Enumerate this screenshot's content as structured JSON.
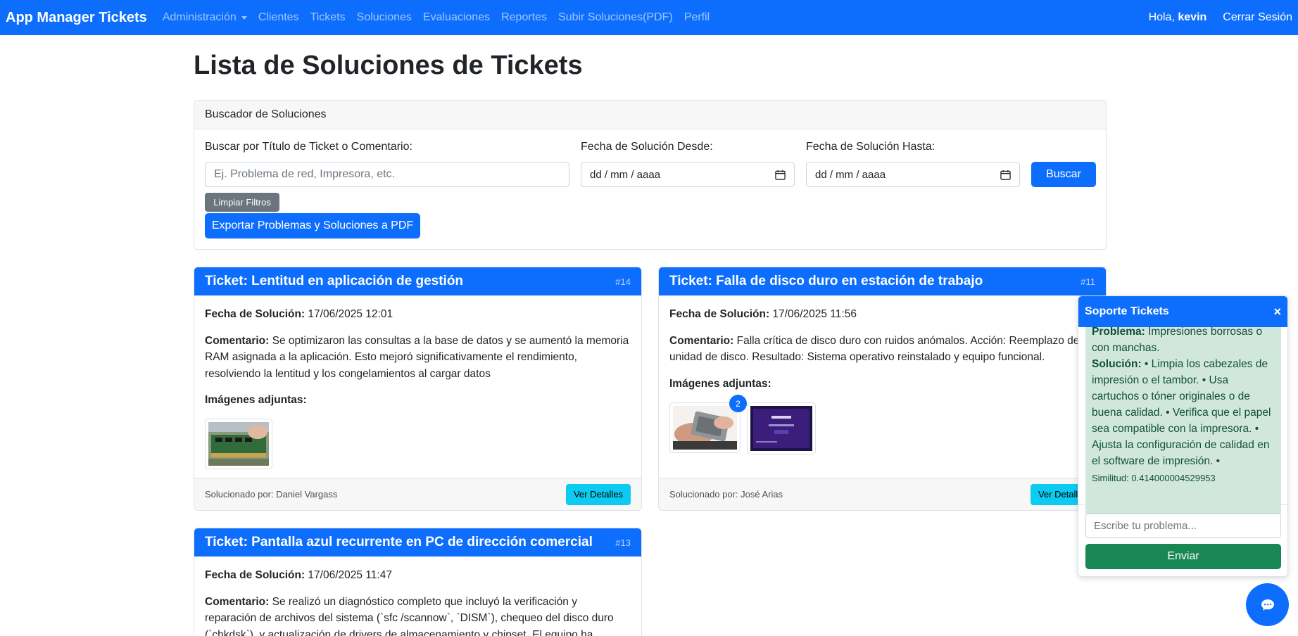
{
  "navbar": {
    "brand": "App Manager Tickets",
    "links": [
      "Administración",
      "Clientes",
      "Tickets",
      "Soluciones",
      "Evaluaciones",
      "Reportes",
      "Subir Soluciones(PDF)",
      "Perfil"
    ],
    "greeting": "Hola,",
    "username": "kevin",
    "logout": "Cerrar Sesión"
  },
  "page": {
    "title": "Lista de Soluciones de Tickets"
  },
  "search": {
    "header": "Buscador de Soluciones",
    "query_label": "Buscar por Título de Ticket o Comentario:",
    "query_placeholder": "Ej. Problema de red, Impresora, etc.",
    "query_value": "",
    "from_label": "Fecha de Solución Desde:",
    "from_value": "dd / mm / aaaa",
    "to_label": "Fecha de Solución Hasta:",
    "to_value": "dd / mm / aaaa",
    "search_button": "Buscar",
    "clear_button": "Limpiar Filtros",
    "export_button": "Exportar Problemas y Soluciones a PDF"
  },
  "solutions": [
    {
      "title": "Ticket: Lentitud en aplicación de gestión",
      "id": "#14",
      "date_label": "Fecha de Solución:",
      "date": "17/06/2025 12:01",
      "comment_label": "Comentario:",
      "comment": "Se optimizaron las consultas a la base de datos y se aumentó la memoria RAM asignada a la aplicación. Esto mejoró significativamente el rendimiento, resolviendo la lentitud y los congelamientos al cargar datos",
      "images_label": "Imágenes adjuntas:",
      "solved_by": "Solucionado por: Daniel Vargass",
      "details_button": "Ver Detalles"
    },
    {
      "title": "Ticket: Falla de disco duro en estación de trabajo",
      "id": "#11",
      "date_label": "Fecha de Solución:",
      "date": "17/06/2025 11:56",
      "comment_label": "Comentario:",
      "comment": "Falla crítica de disco duro con ruidos anómalos. Acción: Reemplazo de la unidad de disco. Resultado: Sistema operativo reinstalado y equipo funcional.",
      "images_label": "Imágenes adjuntas:",
      "image_badge": "2",
      "solved_by": "Solucionado por: José Arias",
      "details_button": "Ver Detalles"
    },
    {
      "title": "Ticket: Pantalla azul recurrente en PC de dirección comercial",
      "id": "#13",
      "date_label": "Fecha de Solución:",
      "date": "17/06/2025 11:47",
      "comment_label": "Comentario:",
      "comment": "Se realizó un diagnóstico completo que incluyó la verificación y reparación de archivos del sistema (`sfc /scannow`, `DISM`), chequeo del disco duro (`chkdsk`), y actualización de drivers de almacenamiento y chipset. El equipo ha"
    }
  ],
  "chat": {
    "title": "Soporte Tickets",
    "close": "×",
    "problem_label": "Problema:",
    "problem": "Impresiones borrosas o con manchas.",
    "solution_label": "Solución:",
    "solution": "• Limpia los cabezales de impresión o el tambor. • Usa cartuchos o tóner originales o de buena calidad. • Verifica que el papel sea compatible con la impresora. • Ajusta la configuración de calidad en el software de impresión. •",
    "similarity": "Similitud: 0.414000004529953",
    "input_placeholder": "Escribe tu problema...",
    "send_button": "Enviar"
  },
  "colors": {
    "primary": "#0d6efd",
    "success": "#198754",
    "info": "#0dcaf0",
    "secondary": "#6c757d",
    "alert_bg": "#d1e7dd"
  }
}
